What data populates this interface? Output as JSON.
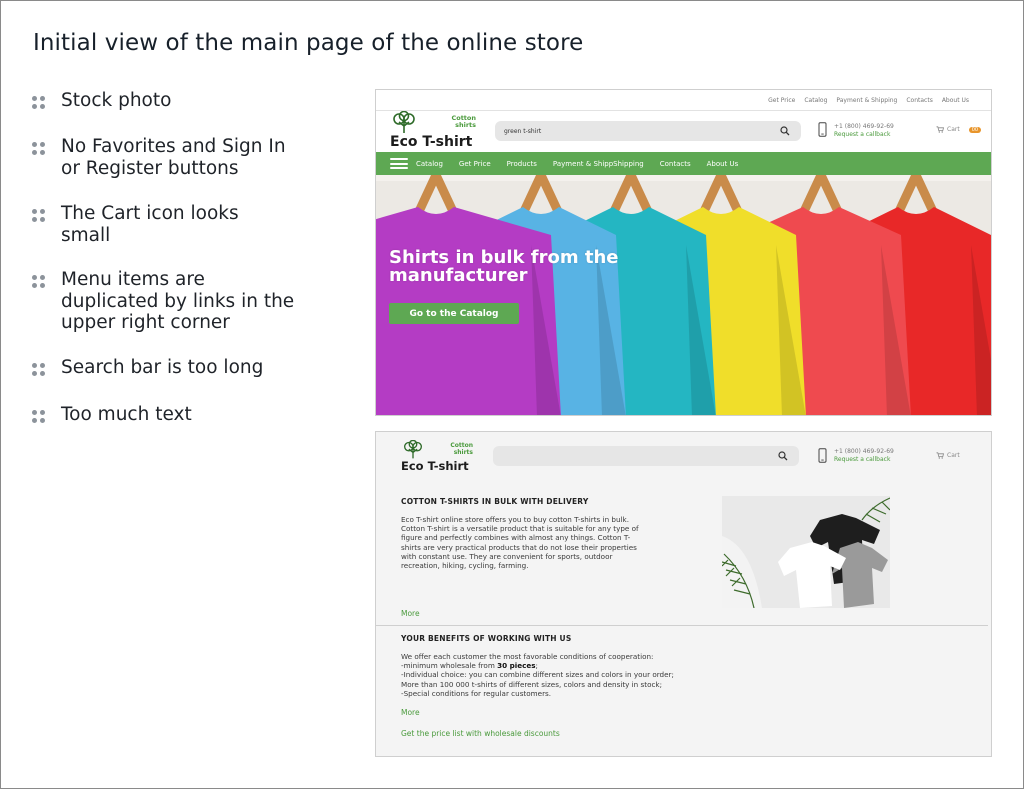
{
  "slide": {
    "title": "Initial view of the main page of the online store",
    "notes": [
      "Stock photo",
      "No Favorites and Sign In or Register buttons",
      "The Cart icon looks small",
      "Menu items are duplicated by links in the upper right corner",
      "Search bar is too long",
      "Too much text"
    ]
  },
  "brand": {
    "name": "Eco T-shirt",
    "tagline_line1": "Cotton",
    "tagline_line2": "shirts",
    "green": "#5ea853",
    "link_green": "#4a9a3c",
    "badge_orange": "#e8952b"
  },
  "mockup1": {
    "top_links": [
      "Get Price",
      "Catalog",
      "Payment & Shipping",
      "Contacts",
      "About Us"
    ],
    "search_value": "green t-shirt",
    "phone": "+1 (800) 469-92-69",
    "callback": "Request a callback",
    "cart_label": "Cart",
    "cart_count": "00",
    "nav": [
      "Catalog",
      "Get Price",
      "Products",
      "Payment & ShippShipping",
      "Contacts",
      "About Us"
    ],
    "hero_title": "Shirts in bulk from the manufacturer",
    "hero_button": "Go to the Catalog",
    "shirt_colors": [
      "#b43cc4",
      "#58b3e4",
      "#24b6c2",
      "#f0de2a",
      "#ef4a4f",
      "#e82828"
    ]
  },
  "mockup2": {
    "search_value": "",
    "phone": "+1 (800) 469-92-69",
    "callback": "Request a callback",
    "cart_label": "Cart",
    "section1_title": "COTTON T-SHIRTS IN BULK WITH DELIVERY",
    "section1_lines": [
      "Eco T-shirt online store offers you to buy cotton T-shirts in bulk.",
      "Cotton T-shirt is a versatile product that is suitable for any type of",
      "figure and perfectly combines with almost any things. Cotton T-",
      "shirts are very practical products that do not lose their properties",
      "with constant use. They are convenient for sports, outdoor",
      "recreation, hiking, cycling, farming."
    ],
    "more_label": "More",
    "section2_title": "YOUR BENEFITS OF WORKING WITH US",
    "benefit_intro": "We offer each customer the most favorable conditions of cooperation:",
    "benefit_min_prefix": "-minimum wholesale from ",
    "benefit_min_bold": "30 pieces",
    "benefit_min_suffix": ";",
    "benefit_lines": [
      "-Individual choice: you can combine different sizes and colors in your order;",
      "More than 100 000 t-shirts of different sizes, colors and density in stock;",
      "-Special conditions for regular customers."
    ],
    "more_label2": "More",
    "pricelist_link": "Get the price list with wholesale discounts"
  }
}
